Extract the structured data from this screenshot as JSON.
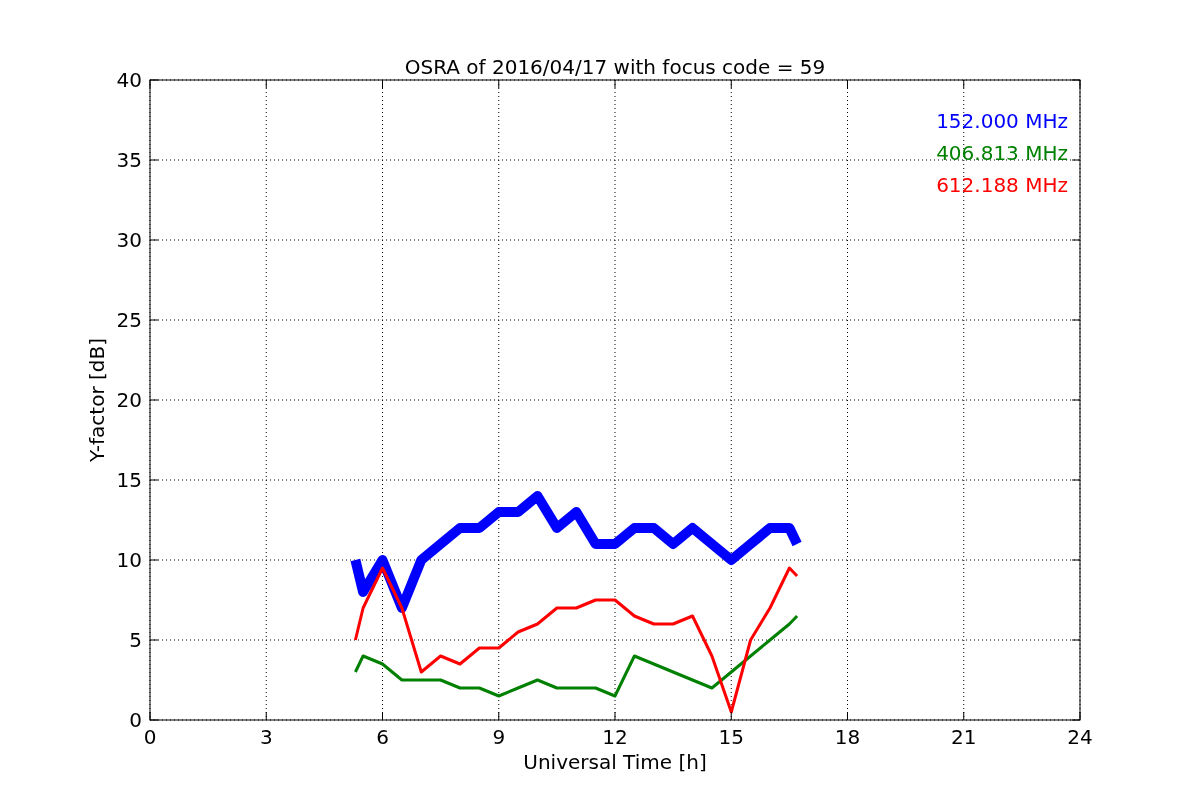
{
  "chart_data": {
    "type": "line",
    "title": "OSRA of 2016/04/17 with focus code = 59",
    "xlabel": "Universal Time [h]",
    "ylabel": "Y-factor [dB]",
    "x": [
      5.3,
      5.5,
      6,
      6.5,
      7,
      7.5,
      8,
      8.5,
      9,
      9.5,
      10,
      10.5,
      11,
      11.5,
      12,
      12.5,
      13,
      13.5,
      14,
      14.5,
      15,
      15.5,
      16,
      16.5,
      16.7
    ],
    "series": [
      {
        "name": "152.000 MHz",
        "color": "#0000ff",
        "values": [
          10,
          8,
          10,
          7,
          10,
          11,
          12,
          12,
          13,
          13,
          14,
          12,
          13,
          11,
          11,
          12,
          12,
          11,
          12,
          11,
          10,
          11,
          12,
          12,
          11
        ]
      },
      {
        "name": "406.813 MHz",
        "color": "#008000",
        "values": [
          3,
          4,
          3.5,
          2.5,
          2.5,
          2.5,
          2,
          2,
          1.5,
          2,
          2.5,
          2,
          2,
          2,
          1.5,
          4,
          3.5,
          3,
          2.5,
          2,
          3,
          4,
          5,
          6,
          6.5
        ]
      },
      {
        "name": "612.188 MHz",
        "color": "#ff0000",
        "values": [
          5,
          7,
          9.5,
          7,
          3,
          4,
          3.5,
          4.5,
          4.5,
          5.5,
          6,
          7,
          7,
          7.5,
          7.5,
          6.5,
          6,
          6,
          6.5,
          4,
          0.5,
          5,
          7,
          9.5,
          9
        ]
      }
    ],
    "xlim": [
      0,
      24
    ],
    "ylim": [
      0,
      40
    ],
    "xticks": [
      0,
      3,
      6,
      9,
      12,
      15,
      18,
      21,
      24
    ],
    "yticks": [
      0,
      5,
      10,
      15,
      20,
      25,
      30,
      35,
      40
    ],
    "grid": true
  }
}
